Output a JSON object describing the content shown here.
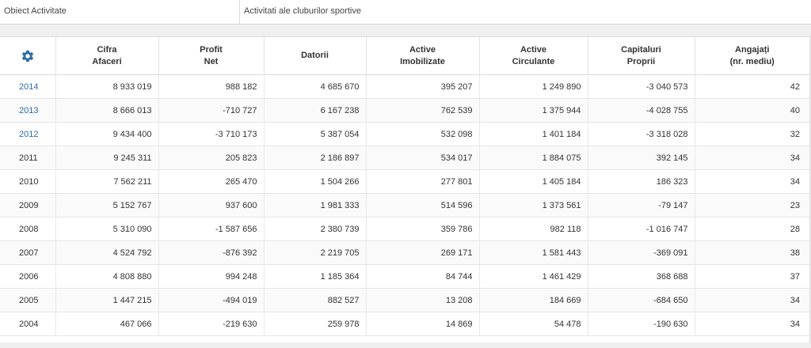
{
  "header": {
    "label": "Obiect Activitate",
    "value": "Activitati ale cluburilor sportive"
  },
  "table": {
    "settings_icon": "gear-icon",
    "accent_color": "#2d6ca2",
    "columns": [
      {
        "line1": "Cifra",
        "line2": "Afaceri"
      },
      {
        "line1": "Profit",
        "line2": "Net"
      },
      {
        "line1": "Datorii",
        "line2": ""
      },
      {
        "line1": "Active",
        "line2": "Imobilizate"
      },
      {
        "line1": "Active",
        "line2": "Circulante"
      },
      {
        "line1": "Capitaluri",
        "line2": "Proprii"
      },
      {
        "line1": "Angajați",
        "line2": "(nr. mediu)"
      }
    ],
    "rows": [
      {
        "year": "2014",
        "linked": true,
        "cells": [
          "8 933 019",
          "988 182",
          "4 685 670",
          "395 207",
          "1 249 890",
          "-3 040 573",
          "42"
        ]
      },
      {
        "year": "2013",
        "linked": true,
        "cells": [
          "8 666 013",
          "-710 727",
          "6 167 238",
          "762 539",
          "1 375 944",
          "-4 028 755",
          "40"
        ]
      },
      {
        "year": "2012",
        "linked": true,
        "cells": [
          "9 434 400",
          "-3 710 173",
          "5 387 054",
          "532 098",
          "1 401 184",
          "-3 318 028",
          "32"
        ]
      },
      {
        "year": "2011",
        "linked": false,
        "cells": [
          "9 245 311",
          "205 823",
          "2 186 897",
          "534 017",
          "1 884 075",
          "392 145",
          "34"
        ]
      },
      {
        "year": "2010",
        "linked": false,
        "cells": [
          "7 562 211",
          "265 470",
          "1 504 266",
          "277 801",
          "1 405 184",
          "186 323",
          "34"
        ]
      },
      {
        "year": "2009",
        "linked": false,
        "cells": [
          "5 152 767",
          "937 600",
          "1 981 333",
          "514 596",
          "1 373 561",
          "-79 147",
          "23"
        ]
      },
      {
        "year": "2008",
        "linked": false,
        "cells": [
          "5 310 090",
          "-1 587 656",
          "2 380 739",
          "359 786",
          "982 118",
          "-1 016 747",
          "28"
        ]
      },
      {
        "year": "2007",
        "linked": false,
        "cells": [
          "4 524 792",
          "-876 392",
          "2 219 705",
          "269 171",
          "1 581 443",
          "-369 091",
          "38"
        ]
      },
      {
        "year": "2006",
        "linked": false,
        "cells": [
          "4 808 880",
          "994 248",
          "1 185 364",
          "84 744",
          "1 461 429",
          "368 688",
          "37"
        ]
      },
      {
        "year": "2005",
        "linked": false,
        "cells": [
          "1 447 215",
          "-494 019",
          "882 527",
          "13 208",
          "184 669",
          "-684 650",
          "34"
        ]
      },
      {
        "year": "2004",
        "linked": false,
        "cells": [
          "467 066",
          "-219 630",
          "259 978",
          "14 869",
          "54 478",
          "-190 630",
          "34"
        ]
      }
    ]
  }
}
